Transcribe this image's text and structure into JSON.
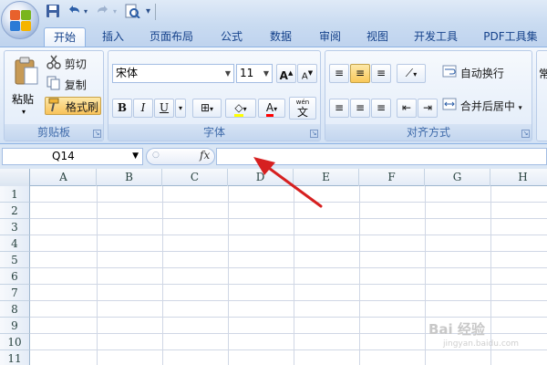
{
  "quick_access": {
    "save_icon": "save-icon",
    "undo_icon": "undo-icon",
    "redo_icon": "redo-icon",
    "preview_icon": "print-preview-icon",
    "customize": "▾"
  },
  "tabs": [
    "开始",
    "插入",
    "页面布局",
    "公式",
    "数据",
    "审阅",
    "视图",
    "开发工具",
    "PDF工具集"
  ],
  "clipboard": {
    "paste": "粘贴",
    "cut": "剪切",
    "copy": "复制",
    "format_painter": "格式刷",
    "label": "剪贴板"
  },
  "font": {
    "family": "宋体",
    "size": "11",
    "grow": "A",
    "shrink": "A",
    "bold": "B",
    "italic": "I",
    "underline": "U",
    "wen": "wén",
    "wen_char": "文",
    "label": "字体"
  },
  "alignment": {
    "wrap": "自动换行",
    "merge": "合并后居中",
    "label": "对齐方式",
    "more": "常"
  },
  "formula": {
    "name_box": "Q14",
    "fx": "fx",
    "value": ""
  },
  "columns": [
    "A",
    "B",
    "C",
    "D",
    "E",
    "F",
    "G",
    "H"
  ],
  "rows": [
    "1",
    "2",
    "3",
    "4",
    "5",
    "6",
    "7",
    "8",
    "9",
    "10",
    "11"
  ],
  "watermark": {
    "main": "Bai 经验",
    "sub": "jingyan.baidu.com"
  },
  "colors": {
    "ribbon_accent": "#15428b",
    "fill_color": "#ffff00",
    "font_color": "#ff0000",
    "arrow": "#d62020"
  }
}
